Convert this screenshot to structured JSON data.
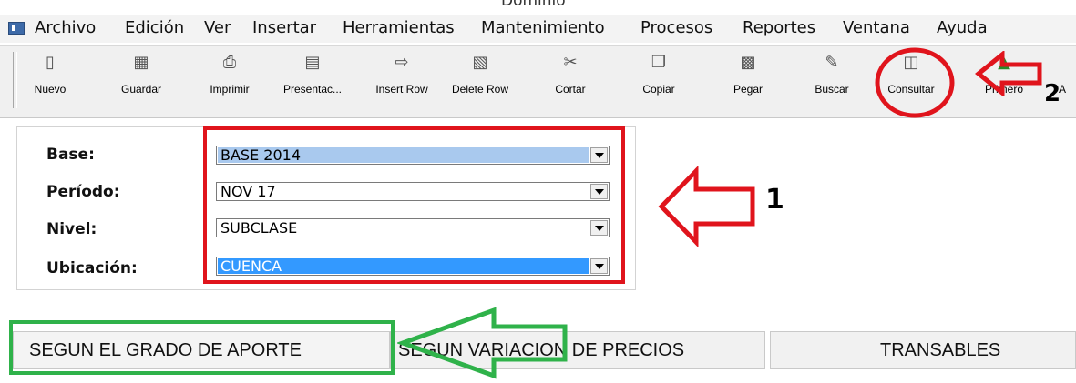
{
  "window": {
    "title": "Dominio"
  },
  "menu": [
    "Archivo",
    "Edición",
    "Ver",
    "Insertar",
    "Herramientas",
    "Mantenimiento",
    "Procesos",
    "Reportes",
    "Ventana",
    "Ayuda"
  ],
  "toolbar": [
    {
      "label": "Nuevo",
      "icon": "new-file-icon"
    },
    {
      "label": "Guardar",
      "icon": "save-icon"
    },
    {
      "label": "Imprimir",
      "icon": "print-icon"
    },
    {
      "label": "Presentac...",
      "icon": "preview-icon"
    },
    {
      "label": "Insert Row",
      "icon": "insert-row-icon"
    },
    {
      "label": "Delete Row",
      "icon": "delete-icon"
    },
    {
      "label": "Cortar",
      "icon": "cut-icon"
    },
    {
      "label": "Copiar",
      "icon": "copy-icon"
    },
    {
      "label": "Pegar",
      "icon": "paste-icon"
    },
    {
      "label": "Buscar",
      "icon": "search-icon"
    },
    {
      "label": "Consultar",
      "icon": "query-icon"
    },
    {
      "label": "Primero",
      "icon": "first-icon"
    },
    {
      "label": "A",
      "icon": ""
    }
  ],
  "form": {
    "base_label": "Base:",
    "base_value": "BASE 2014",
    "periodo_label": "Período:",
    "periodo_value": "NOV 17",
    "nivel_label": "Nivel:",
    "nivel_value": "SUBCLASE",
    "ubicacion_label": "Ubicación:",
    "ubicacion_value": "CUENCA"
  },
  "tabs": [
    "SEGUN EL GRADO DE APORTE",
    "SEGUN VARIACION DE PRECIOS",
    "TRANSABLES"
  ],
  "annotations": {
    "label_1": "1",
    "label_2": "2"
  },
  "colors": {
    "annotation_red": "#e0141c",
    "annotation_green": "#2fb24a",
    "selection_blue": "#3399ff",
    "selection_light": "#a9c9ee"
  }
}
